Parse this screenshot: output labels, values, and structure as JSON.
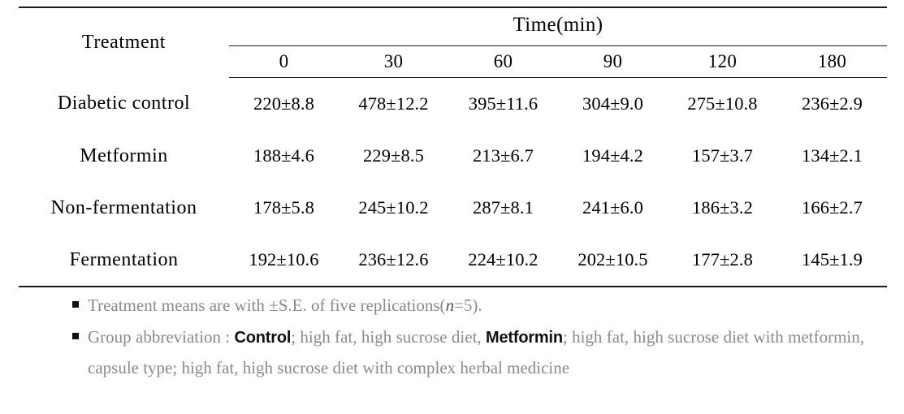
{
  "table": {
    "row_header_label": "Treatment",
    "group_header_label": "Time(min)",
    "time_ticks": [
      "0",
      "30",
      "60",
      "90",
      "120",
      "180"
    ],
    "rows": [
      {
        "label": "Diabetic control",
        "values": [
          "220±8.8",
          "478±12.2",
          "395±11.6",
          "304±9.0",
          "275±10.8",
          "236±2.9"
        ]
      },
      {
        "label": "Metformin",
        "values": [
          "188±4.6",
          "229±8.5",
          "213±6.7",
          "194±4.2",
          "157±3.7",
          "134±2.1"
        ]
      },
      {
        "label": "Non-fermentation",
        "values": [
          "178±5.8",
          "245±10.2",
          "287±8.1",
          "241±6.0",
          "186±3.2",
          "166±2.7"
        ]
      },
      {
        "label": "Fermentation",
        "values": [
          "192±10.6",
          "236±12.6",
          "224±10.2",
          "202±10.5",
          "177±2.8",
          "145±1.9"
        ]
      }
    ]
  },
  "footnotes": {
    "note1": {
      "lead": "Treatment means are with ±S.E. of five replications(",
      "italic": "n",
      "tail": "=5)."
    },
    "note2": {
      "lead": "Group abbreviation : ",
      "strong1": "Control",
      "mid": "; high fat, high sucrose diet, ",
      "strong2": "Metformin",
      "tail": "; high fat, high sucrose diet with metformin, capsule type; high fat, high sucrose diet with complex herbal medicine"
    }
  },
  "chart_data": {
    "type": "table",
    "title": "Blood glucose response (mg/dL) by treatment over time",
    "xlabel": "Time(min)",
    "ylabel": "Treatment",
    "categories": [
      "0",
      "30",
      "60",
      "90",
      "120",
      "180"
    ],
    "series": [
      {
        "name": "Diabetic control",
        "values": [
          220,
          478,
          395,
          304,
          275,
          236
        ],
        "errors": [
          8.8,
          12.2,
          11.6,
          9.0,
          10.8,
          2.9
        ]
      },
      {
        "name": "Metformin",
        "values": [
          188,
          229,
          213,
          194,
          157,
          134
        ],
        "errors": [
          4.6,
          8.5,
          6.7,
          4.2,
          3.7,
          2.1
        ]
      },
      {
        "name": "Non-fermentation",
        "values": [
          178,
          245,
          287,
          241,
          186,
          166
        ],
        "errors": [
          5.8,
          10.2,
          8.1,
          6.0,
          3.2,
          2.7
        ]
      },
      {
        "name": "Fermentation",
        "values": [
          192,
          236,
          224,
          202,
          177,
          145
        ],
        "errors": [
          10.6,
          12.6,
          10.2,
          10.5,
          2.8,
          1.9
        ]
      }
    ]
  }
}
